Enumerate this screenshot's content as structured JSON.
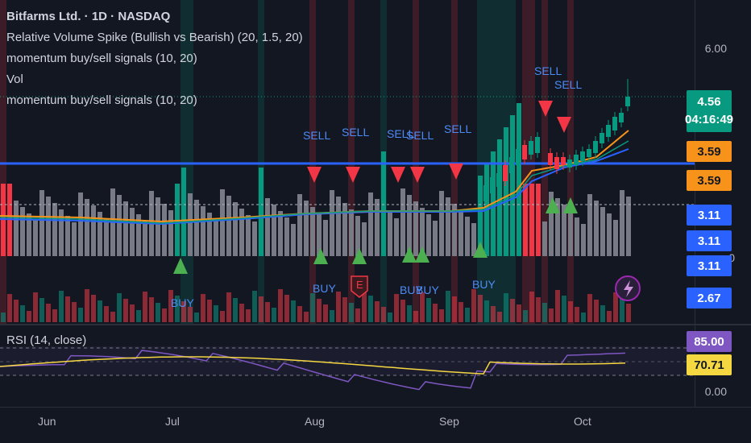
{
  "legend": {
    "symbol": "Bitfarms Ltd. · 1D · NASDAQ",
    "indicator_1": "Relative Volume Spike (Bullish vs Bearish) (20, 1.5, 20)",
    "indicator_2": "momentum buy/sell signals (10, 20)",
    "indicator_3": "Vol",
    "indicator_4": "momentum buy/sell signals (10, 20)"
  },
  "rsi_label": "RSI (14, close)",
  "price_axis": {
    "top": "6.00",
    "mid": "0",
    "bottom_rsi": "0.00"
  },
  "price_tags": {
    "last": "4.56",
    "countdown": "04:16:49",
    "ma1": "3.59",
    "ma2": "3.59",
    "b1": "3.11",
    "b2": "3.11",
    "b3": "3.11",
    "b4": "2.67",
    "rsi": "85.00",
    "rsi_ma": "70.71"
  },
  "x_axis": [
    "Jun",
    "Jul",
    "Aug",
    "Sep",
    "Oct"
  ],
  "signals": {
    "sell": [
      "SELL",
      "SELL",
      "SELL",
      "SELL",
      "SELL",
      "SELL",
      "SELL"
    ],
    "buy": [
      "BUY",
      "BUY",
      "BUY",
      "BUY",
      "BUY"
    ],
    "earnings": "E"
  },
  "colors": {
    "background": "#131722",
    "bull": "#089981",
    "bear": "#f23645",
    "volume_gray": "#787b86",
    "signal_blue": "#2962ff",
    "ma_orange": "#f7931a",
    "rsi_line": "#7e57c2",
    "rsi_ma": "#f5d742"
  },
  "icons": [
    "lightning-icon",
    "earnings-icon"
  ]
}
